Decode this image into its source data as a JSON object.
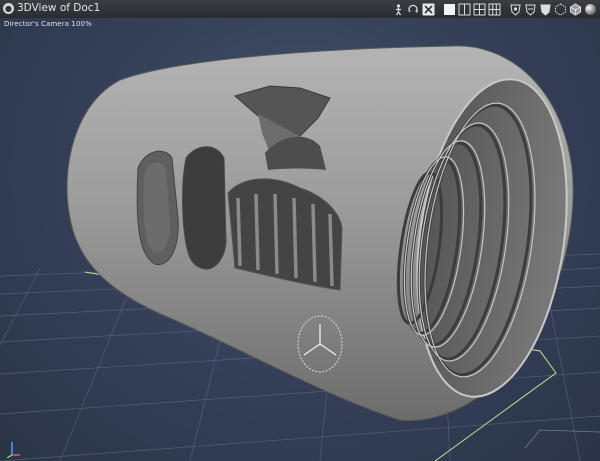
{
  "window": {
    "title": "3DView of Doc1"
  },
  "viewport": {
    "camera_label": "Director's Camera 100%"
  },
  "toolbar": {
    "icons": [
      "pose-icon",
      "rotate-icon",
      "navigator-icon",
      "display-mode-1-icon",
      "display-mode-2-icon",
      "display-mode-3-icon",
      "display-mode-4-icon",
      "sphere-display-icon",
      "sphere-display-2-icon",
      "sphere-display-3-icon",
      "sphere-display-4-icon",
      "cube-icon",
      "shaded-sphere-icon"
    ]
  },
  "colors": {
    "titlebar": "#2e3036",
    "grid": "#5d6a85",
    "floor_border": "#c8e09a",
    "object": "#8e8e8e"
  }
}
